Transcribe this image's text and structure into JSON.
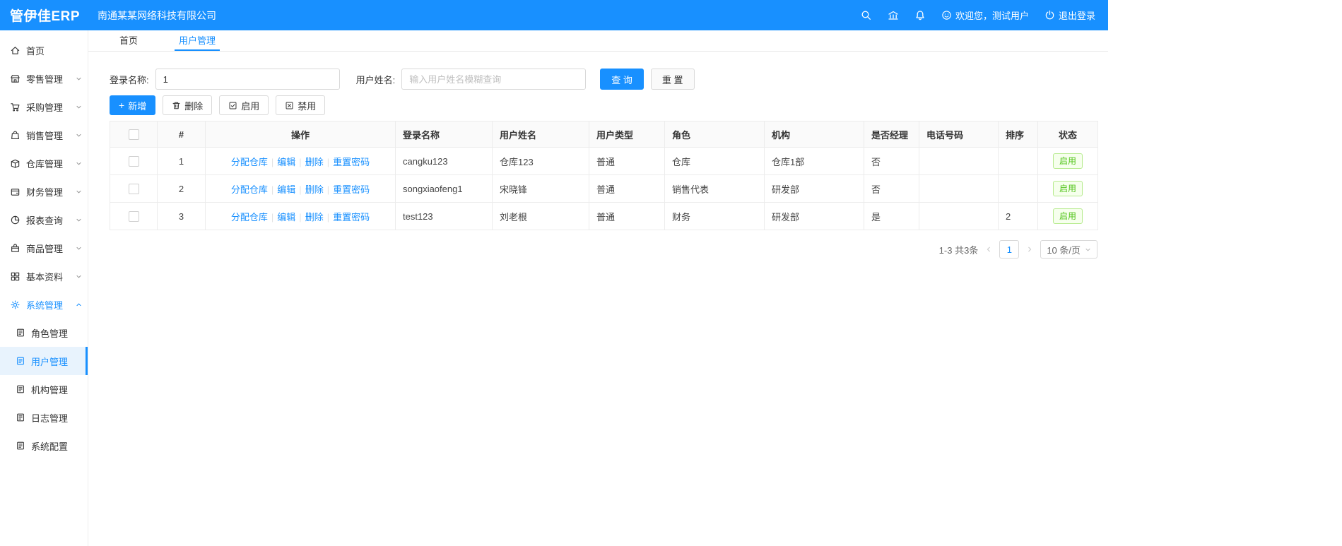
{
  "header": {
    "logo": "管伊佳ERP",
    "company": "南通某某网络科技有限公司",
    "welcome": "欢迎您，测试用户",
    "logout": "退出登录"
  },
  "sidebar": {
    "items": [
      {
        "label": "首页"
      },
      {
        "label": "零售管理"
      },
      {
        "label": "采购管理"
      },
      {
        "label": "销售管理"
      },
      {
        "label": "仓库管理"
      },
      {
        "label": "财务管理"
      },
      {
        "label": "报表查询"
      },
      {
        "label": "商品管理"
      },
      {
        "label": "基本资料"
      },
      {
        "label": "系统管理"
      }
    ],
    "subitems": [
      {
        "label": "角色管理"
      },
      {
        "label": "用户管理"
      },
      {
        "label": "机构管理"
      },
      {
        "label": "日志管理"
      },
      {
        "label": "系统配置"
      }
    ]
  },
  "tabs": [
    {
      "label": "首页"
    },
    {
      "label": "用户管理"
    }
  ],
  "search": {
    "login_label": "登录名称:",
    "login_value": "1",
    "name_label": "用户姓名:",
    "name_placeholder": "输入用户姓名模糊查询",
    "query_button": "查 询",
    "reset_button": "重 置"
  },
  "toolbar": {
    "add": "新增",
    "delete": "删除",
    "enable": "启用",
    "disable": "禁用"
  },
  "table": {
    "headers": [
      "#",
      "操作",
      "登录名称",
      "用户姓名",
      "用户类型",
      "角色",
      "机构",
      "是否经理",
      "电话号码",
      "排序",
      "状态"
    ],
    "action_links": [
      "分配仓库",
      "编辑",
      "删除",
      "重置密码"
    ],
    "rows": [
      {
        "index": "1",
        "login": "cangku123",
        "name": "仓库123",
        "type": "普通",
        "role": "仓库",
        "org": "仓库1部",
        "manager": "否",
        "phone": "",
        "sort": "",
        "status": "启用"
      },
      {
        "index": "2",
        "login": "songxiaofeng1",
        "name": "宋晓锋",
        "type": "普通",
        "role": "销售代表",
        "org": "研发部",
        "manager": "否",
        "phone": "",
        "sort": "",
        "status": "启用"
      },
      {
        "index": "3",
        "login": "test123",
        "name": "刘老根",
        "type": "普通",
        "role": "财务",
        "org": "研发部",
        "manager": "是",
        "phone": "",
        "sort": "2",
        "status": "启用"
      }
    ]
  },
  "pagination": {
    "total": "1-3 共3条",
    "page": "1",
    "page_size": "10 条/页"
  },
  "icons": {
    "search-icon": "magnifier",
    "bank-icon": "bank building",
    "bell-icon": "notification bell",
    "smiley-icon": "smiley face",
    "logout-icon": "power",
    "chevron-down-icon": "v",
    "chevron-up-icon": "^"
  },
  "colors": {
    "primary": "#1890ff",
    "status_green": "#52c41a"
  }
}
